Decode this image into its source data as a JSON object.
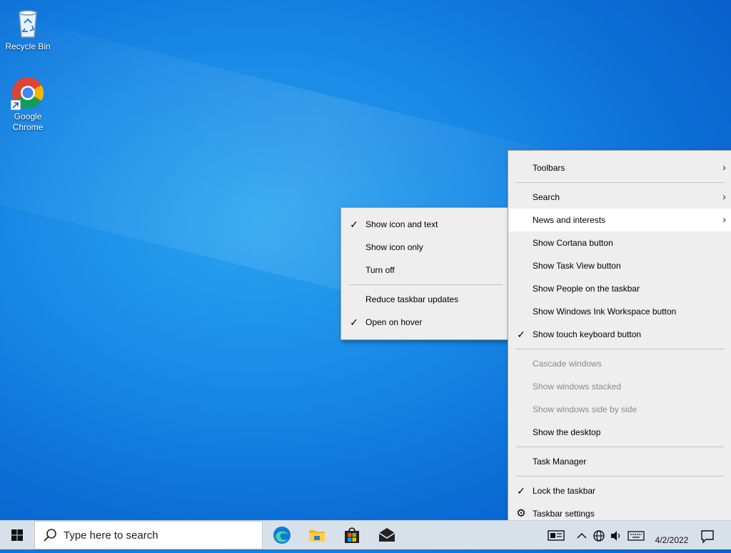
{
  "desktop": {
    "icons": [
      {
        "label": "Recycle Bin",
        "icon": "recycle-bin-icon"
      },
      {
        "label": "Google Chrome",
        "icon": "chrome-icon"
      }
    ]
  },
  "context_menu": {
    "items": [
      {
        "label": "Toolbars",
        "submenu": true
      },
      {
        "label": "Search",
        "submenu": true
      },
      {
        "label": "News and interests",
        "submenu": true,
        "hover": true
      },
      {
        "label": "Show Cortana button"
      },
      {
        "label": "Show Task View button"
      },
      {
        "label": "Show People on the taskbar"
      },
      {
        "label": "Show Windows Ink Workspace button"
      },
      {
        "label": "Show touch keyboard button",
        "checked": true
      },
      {
        "label": "Cascade windows",
        "disabled": true
      },
      {
        "label": "Show windows stacked",
        "disabled": true
      },
      {
        "label": "Show windows side by side",
        "disabled": true
      },
      {
        "label": "Show the desktop"
      },
      {
        "label": "Task Manager"
      },
      {
        "label": "Lock the taskbar",
        "checked": true
      },
      {
        "label": "Taskbar settings",
        "icon": "gear-icon"
      }
    ]
  },
  "submenu": {
    "items": [
      {
        "label": "Show icon and text",
        "checked": true
      },
      {
        "label": "Show icon only"
      },
      {
        "label": "Turn off"
      },
      {
        "label": "Reduce taskbar updates"
      },
      {
        "label": "Open on hover",
        "checked": true
      }
    ]
  },
  "taskbar": {
    "search_placeholder": "Type here to search",
    "pinned": [
      "edge-icon",
      "file-explorer-icon",
      "microsoft-store-icon",
      "mail-icon"
    ],
    "tray": {
      "date": "4/2/2022",
      "icons": [
        "news-icon",
        "chevron-up-icon",
        "network-icon",
        "volume-icon",
        "keyboard-icon",
        "notification-icon"
      ]
    }
  },
  "colors": {
    "menu_bg": "#eeeeee",
    "menu_hover": "#ffffff",
    "disabled_text": "#8a8a8a",
    "taskbar_bg": "#d8e1ea"
  }
}
